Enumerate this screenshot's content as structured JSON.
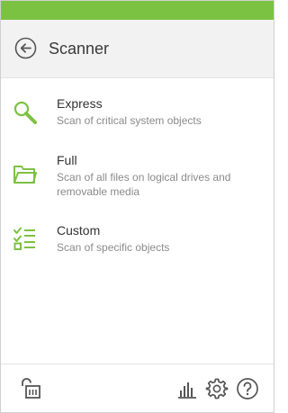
{
  "header": {
    "title": "Scanner",
    "back_icon": "back-arrow-icon"
  },
  "scan_options": [
    {
      "title": "Express",
      "description": "Scan of critical system objects",
      "icon": "magnifier-icon"
    },
    {
      "title": "Full",
      "description": "Scan of all files on logical drives and removable media",
      "icon": "folder-icon"
    },
    {
      "title": "Custom",
      "description": "Scan of specific objects",
      "icon": "checklist-icon"
    }
  ],
  "footer": {
    "icons": [
      "unlock-icon",
      "statistics-icon",
      "settings-gear-icon",
      "help-icon"
    ]
  },
  "colors": {
    "accent_green": "#7cc242",
    "header_bg": "#f2f2f2",
    "title_text": "#333333",
    "description_text": "#8a8a8a",
    "icon_gray": "#555555"
  }
}
